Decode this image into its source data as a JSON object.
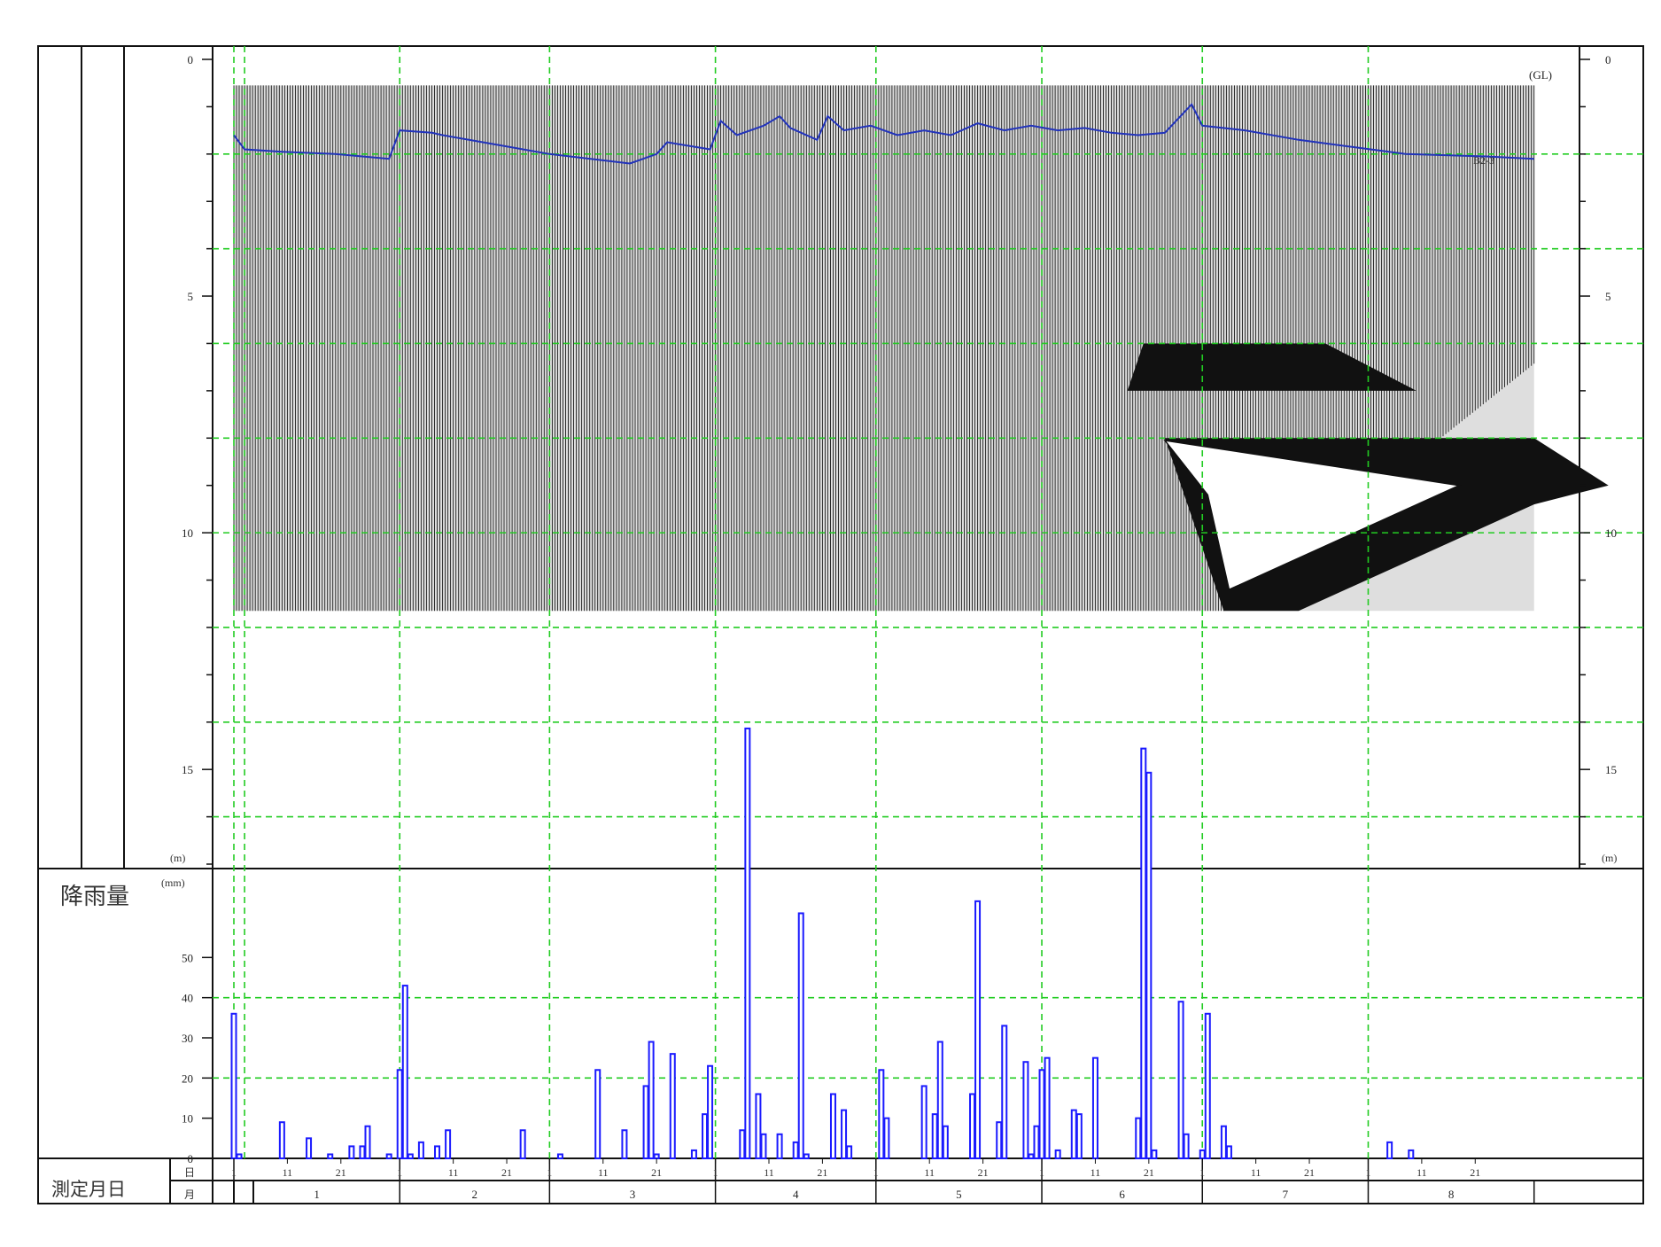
{
  "chart_data": {
    "type": "line",
    "depth_axis": {
      "ylim": [
        0,
        17
      ],
      "ticks": [
        0,
        5,
        10,
        15
      ],
      "unit": "(m)",
      "reference": "(GL)",
      "grid_dashed_green": true
    },
    "groundwater_series": {
      "name": "B2-3",
      "color": "#2233bb",
      "x_day": [
        1,
        3,
        10,
        20,
        25,
        30,
        32,
        38,
        40,
        50,
        60,
        75,
        80,
        82,
        90,
        92,
        95,
        100,
        103,
        105,
        110,
        112,
        115,
        120,
        125,
        130,
        135,
        140,
        145,
        150,
        155,
        160,
        165,
        170,
        175,
        180,
        182,
        190,
        200,
        210,
        220,
        235,
        244
      ],
      "depth": [
        1.6,
        1.9,
        1.95,
        2.0,
        2.05,
        2.1,
        1.5,
        1.55,
        1.6,
        1.8,
        2.0,
        2.2,
        2.0,
        1.75,
        1.9,
        1.3,
        1.6,
        1.4,
        1.2,
        1.45,
        1.7,
        1.2,
        1.5,
        1.4,
        1.6,
        1.5,
        1.6,
        1.35,
        1.5,
        1.4,
        1.5,
        1.45,
        1.55,
        1.6,
        1.55,
        0.95,
        1.4,
        1.5,
        1.7,
        1.85,
        2.0,
        2.05,
        2.1
      ]
    },
    "rainfall": {
      "label": "降雨量",
      "unit": "(mm)",
      "ylim": [
        0,
        60
      ],
      "ticks": [
        0,
        10,
        20,
        30,
        40,
        50
      ],
      "color": "#1a1aff",
      "bars": [
        {
          "day": 1,
          "mm": 36
        },
        {
          "day": 2,
          "mm": 1
        },
        {
          "day": 10,
          "mm": 9
        },
        {
          "day": 15,
          "mm": 5
        },
        {
          "day": 19,
          "mm": 1
        },
        {
          "day": 23,
          "mm": 3
        },
        {
          "day": 25,
          "mm": 3
        },
        {
          "day": 26,
          "mm": 8
        },
        {
          "day": 30,
          "mm": 1
        },
        {
          "day": 32,
          "mm": 22
        },
        {
          "day": 33,
          "mm": 43
        },
        {
          "day": 34,
          "mm": 1
        },
        {
          "day": 36,
          "mm": 4
        },
        {
          "day": 39,
          "mm": 3
        },
        {
          "day": 41,
          "mm": 7
        },
        {
          "day": 55,
          "mm": 7
        },
        {
          "day": 62,
          "mm": 1
        },
        {
          "day": 69,
          "mm": 22
        },
        {
          "day": 74,
          "mm": 7
        },
        {
          "day": 78,
          "mm": 18
        },
        {
          "day": 79,
          "mm": 29
        },
        {
          "day": 80,
          "mm": 1
        },
        {
          "day": 83,
          "mm": 26
        },
        {
          "day": 87,
          "mm": 2
        },
        {
          "day": 89,
          "mm": 11
        },
        {
          "day": 90,
          "mm": 23
        },
        {
          "day": 96,
          "mm": 7
        },
        {
          "day": 97,
          "mm": 107
        },
        {
          "day": 99,
          "mm": 16
        },
        {
          "day": 100,
          "mm": 6
        },
        {
          "day": 103,
          "mm": 6
        },
        {
          "day": 106,
          "mm": 4
        },
        {
          "day": 107,
          "mm": 61
        },
        {
          "day": 108,
          "mm": 1
        },
        {
          "day": 113,
          "mm": 16
        },
        {
          "day": 115,
          "mm": 12
        },
        {
          "day": 116,
          "mm": 3
        },
        {
          "day": 122,
          "mm": 22
        },
        {
          "day": 123,
          "mm": 10
        },
        {
          "day": 130,
          "mm": 18
        },
        {
          "day": 132,
          "mm": 11
        },
        {
          "day": 133,
          "mm": 29
        },
        {
          "day": 134,
          "mm": 8
        },
        {
          "day": 139,
          "mm": 16
        },
        {
          "day": 140,
          "mm": 64
        },
        {
          "day": 144,
          "mm": 9
        },
        {
          "day": 145,
          "mm": 33
        },
        {
          "day": 149,
          "mm": 24
        },
        {
          "day": 150,
          "mm": 1
        },
        {
          "day": 151,
          "mm": 8
        },
        {
          "day": 152,
          "mm": 22
        },
        {
          "day": 153,
          "mm": 25
        },
        {
          "day": 155,
          "mm": 2
        },
        {
          "day": 158,
          "mm": 12
        },
        {
          "day": 159,
          "mm": 11
        },
        {
          "day": 162,
          "mm": 25
        },
        {
          "day": 170,
          "mm": 10
        },
        {
          "day": 171,
          "mm": 102
        },
        {
          "day": 172,
          "mm": 96
        },
        {
          "day": 173,
          "mm": 2
        },
        {
          "day": 178,
          "mm": 39
        },
        {
          "day": 179,
          "mm": 6
        },
        {
          "day": 182,
          "mm": 2
        },
        {
          "day": 183,
          "mm": 36
        },
        {
          "day": 186,
          "mm": 8
        },
        {
          "day": 187,
          "mm": 3
        },
        {
          "day": 217,
          "mm": 4
        },
        {
          "day": 221,
          "mm": 2
        }
      ]
    },
    "x_axis": {
      "row_day_label": "日",
      "row_month_label": "月",
      "section_label": "測定月日",
      "day_ticks": [
        "1",
        "11",
        "21"
      ],
      "months": [
        {
          "label": "1",
          "start": 1,
          "days": 31
        },
        {
          "label": "2",
          "start": 32,
          "days": 28
        },
        {
          "label": "3",
          "start": 60,
          "days": 31
        },
        {
          "label": "4",
          "start": 91,
          "days": 30
        },
        {
          "label": "5",
          "start": 121,
          "days": 31
        },
        {
          "label": "6",
          "start": 152,
          "days": 30
        },
        {
          "label": "7",
          "start": 182,
          "days": 31
        },
        {
          "label": "8",
          "start": 213,
          "days": 31
        }
      ]
    }
  }
}
